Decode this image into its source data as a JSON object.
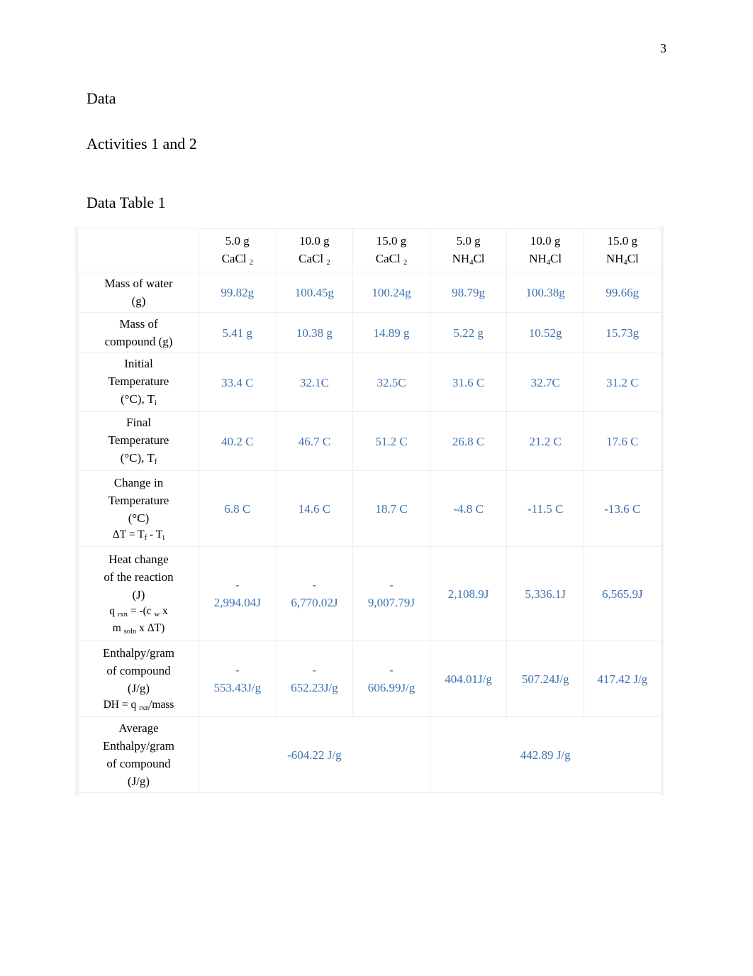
{
  "document": {
    "page_number": "3",
    "headings": {
      "section": "Data",
      "activities": "Activities 1 and 2",
      "table_title": "Data Table 1"
    }
  },
  "table": {
    "column_headers": [
      {
        "amount": "5.0 g",
        "compound": "CaCl",
        "sub": "2",
        "spaced_sub": true
      },
      {
        "amount": "10.0 g",
        "compound": "CaCl",
        "sub": "2",
        "spaced_sub": true
      },
      {
        "amount": "15.0 g",
        "compound": "CaCl",
        "sub": "2",
        "spaced_sub": true
      },
      {
        "amount": "5.0 g",
        "compound": "NH",
        "sub": "4",
        "suffix": "Cl"
      },
      {
        "amount": "10.0 g",
        "compound": "NH",
        "sub": "4",
        "suffix": "Cl"
      },
      {
        "amount": "15.0 g",
        "compound": "NH",
        "sub": "4",
        "suffix": "Cl"
      }
    ],
    "header_labels_flat": [
      "5.0 g CaCl 2",
      "10.0 g CaCl 2",
      "15.0 g CaCl 2",
      "5.0 g NH4Cl",
      "10.0 g NH4Cl",
      "15.0 g NH4Cl"
    ],
    "rows": [
      {
        "label_lines": [
          "Mass of water",
          "(g)"
        ],
        "values": [
          "99.82g",
          "100.45g",
          "100.24g",
          "98.79g",
          "100.38g",
          "99.66g"
        ]
      },
      {
        "label_lines": [
          "Mass of",
          "compound (g)"
        ],
        "values": [
          "5.41 g",
          "10.38 g",
          "14.89 g",
          "5.22 g",
          "10.52g",
          "15.73g"
        ]
      },
      {
        "label_lines": [
          "Initial",
          "Temperature",
          "(°C), T i"
        ],
        "values": [
          "33.4 C",
          "32.1C",
          "32.5C",
          "31.6 C",
          "32.7C",
          "31.2 C"
        ]
      },
      {
        "label_lines": [
          "Final",
          "Temperature",
          "(°C), T f"
        ],
        "values": [
          "40.2 C",
          "46.7 C",
          "51.2 C",
          "26.8 C",
          "21.2 C",
          "17.6 C"
        ]
      },
      {
        "label_lines": [
          "Change in",
          "Temperature",
          "(°C)",
          "ΔT = T f - T i"
        ],
        "values": [
          "6.8 C",
          "14.6 C",
          "18.7 C",
          "-4.8 C",
          "-11.5 C",
          "-13.6 C"
        ]
      },
      {
        "label_lines": [
          "Heat change",
          "of the reaction",
          "(J)",
          "q rxn = -(c w x",
          "m soln x ΔT)"
        ],
        "values": [
          "-\n2,994.04J",
          "-\n6,770.02J",
          "-\n9,007.79J",
          "2,108.9J",
          "5,336.1J",
          "6,565.9J"
        ]
      },
      {
        "label_lines": [
          "Enthalpy/gram",
          "of compound",
          "(J/g)",
          "DH = q rxn/mass"
        ],
        "values": [
          "-\n553.43J/g",
          "-\n652.23J/g",
          "-\n606.99J/g",
          "404.01J/g",
          "507.24J/g",
          "417.42  J/g"
        ]
      }
    ],
    "average_row": {
      "label_lines": [
        "Average",
        "Enthalpy/gram",
        "of compound",
        "(J/g)"
      ],
      "cacl2_average": "-604.22 J/g",
      "nh4cl_average": "442.89 J/g"
    }
  },
  "colors": {
    "value_blue": "#3C72B0",
    "text_black": "#000000",
    "grid_line": "#ededed"
  }
}
